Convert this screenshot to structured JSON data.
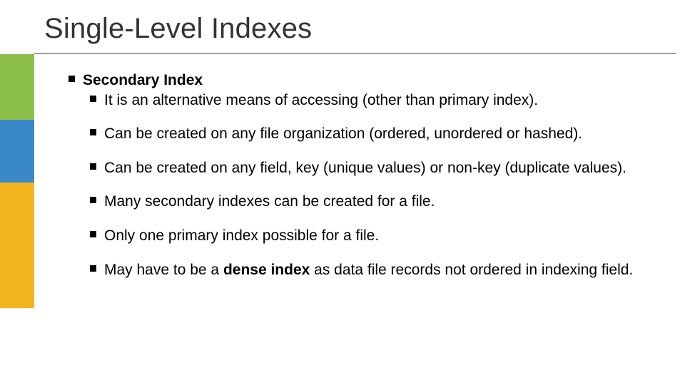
{
  "title": "Single-Level Indexes",
  "secondary_index_heading": "Secondary Index",
  "points": {
    "p1": "It is an alternative means of accessing (other than primary index).",
    "p2": "Can be created on any file organization (ordered, unordered or hashed).",
    "p3": "Can be created on any field, key (unique values) or non-key (duplicate values).",
    "p4": "Many secondary indexes can be created for a file.",
    "p5": "Only one primary index possible for a file.",
    "p6_pre": "May have to be a ",
    "p6_bold": "dense index",
    "p6_post": " as data file records not ordered in indexing field."
  },
  "colors": {
    "green": "#8bbf4a",
    "blue": "#3a87c9",
    "yellow": "#f2b41f",
    "rule": "#9e9e9e"
  }
}
